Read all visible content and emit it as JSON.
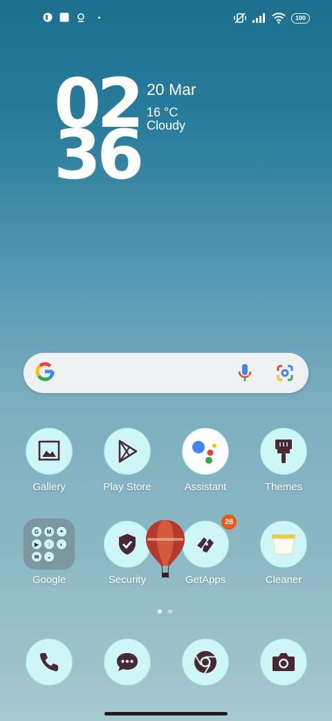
{
  "status_bar": {
    "left_icons": [
      "app-notification-icon",
      "square-notification-icon",
      "location-notification-icon",
      "more-notifications-dot"
    ],
    "right_icons": [
      "vibrate-off-icon",
      "signal-icon",
      "wifi-icon"
    ],
    "battery": "100"
  },
  "clock": {
    "hours": "02",
    "minutes": "36"
  },
  "weather": {
    "date": "20 Mar",
    "temperature": "16 °C",
    "condition": "Cloudy"
  },
  "search_bar": {
    "left_icon": "google-g-icon",
    "mic_icon": "mic-icon",
    "lens_icon": "google-lens-icon"
  },
  "apps_row1": [
    {
      "label": "Gallery",
      "icon": "gallery-icon"
    },
    {
      "label": "Play Store",
      "icon": "play-store-icon"
    },
    {
      "label": "Assistant",
      "icon": "assistant-icon"
    },
    {
      "label": "Themes",
      "icon": "themes-icon"
    }
  ],
  "apps_row2": [
    {
      "label": "Google",
      "icon": "google-folder",
      "folder_glyphs": [
        "G",
        "M",
        "⌖",
        "▶",
        "↑",
        "◐",
        "✉",
        "◒",
        ""
      ]
    },
    {
      "label": "Security",
      "icon": "security-icon"
    },
    {
      "label": "GetApps",
      "icon": "getapps-icon",
      "badge": "28"
    },
    {
      "label": "Cleaner",
      "icon": "cleaner-icon"
    }
  ],
  "page_indicator": {
    "pages": 2,
    "current": 1
  },
  "dock": [
    {
      "icon": "phone-icon"
    },
    {
      "icon": "messages-icon"
    },
    {
      "icon": "chrome-icon"
    },
    {
      "icon": "camera-icon"
    }
  ],
  "colors": {
    "icon_bg": "#cff6f7",
    "glyph": "#4a2832",
    "badge": "#e85a18"
  }
}
